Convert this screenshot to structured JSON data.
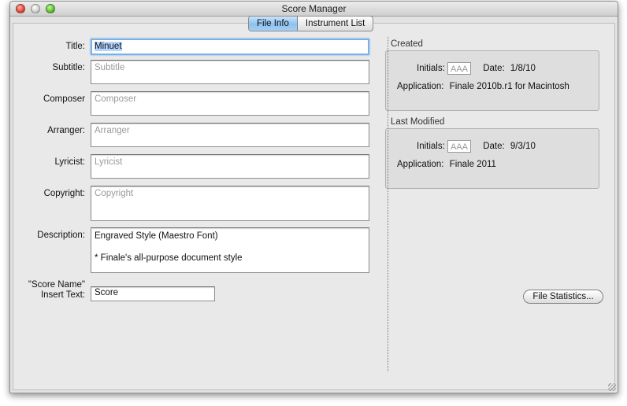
{
  "window": {
    "title": "Score Manager"
  },
  "tabs": [
    {
      "label": "File Info"
    },
    {
      "label": "Instrument List"
    }
  ],
  "form": {
    "title": {
      "label": "Title:",
      "value": "Minuet"
    },
    "subtitle": {
      "label": "Subtitle:",
      "placeholder": "Subtitle"
    },
    "composer": {
      "label": "Composer",
      "placeholder": "Composer"
    },
    "arranger": {
      "label": "Arranger:",
      "placeholder": "Arranger"
    },
    "lyricist": {
      "label": "Lyricist:",
      "placeholder": "Lyricist"
    },
    "copyright": {
      "label": "Copyright:",
      "placeholder": "Copyright"
    },
    "description": {
      "label": "Description:",
      "line1": "Engraved Style (Maestro Font)",
      "line2": "* Finale's all-purpose document style"
    },
    "score_name": {
      "label_line1": "\"Score Name\"",
      "label_line2": "Insert Text:",
      "value": "Score"
    }
  },
  "created": {
    "heading": "Created",
    "initials_label": "Initials:",
    "initials_placeholder": "AAA",
    "date_label": "Date:",
    "date_value": "1/8/10",
    "application_label": "Application:",
    "application_value": "Finale 2010b.r1 for Macintosh"
  },
  "modified": {
    "heading": "Last Modified",
    "initials_label": "Initials:",
    "initials_placeholder": "AAA",
    "date_label": "Date:",
    "date_value": "9/3/10",
    "application_label": "Application:",
    "application_value": "Finale 2011"
  },
  "buttons": {
    "file_statistics": "File Statistics..."
  }
}
